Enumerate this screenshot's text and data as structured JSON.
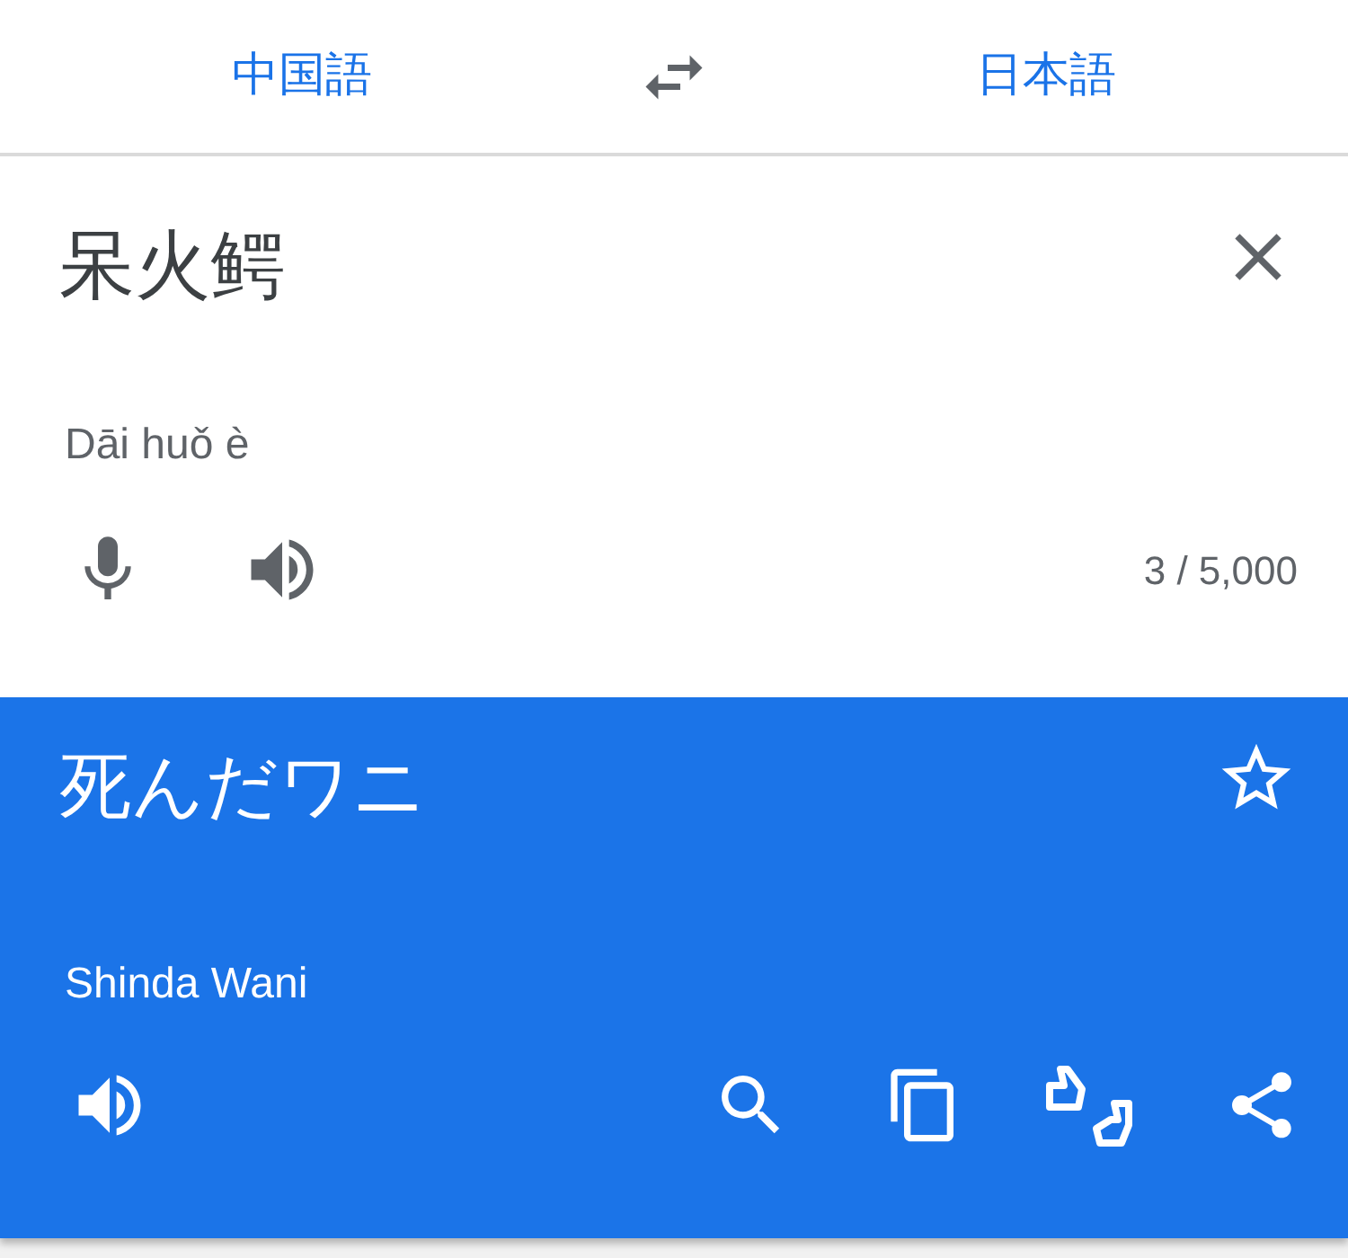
{
  "language_bar": {
    "source_language": "中国語",
    "target_language": "日本語"
  },
  "input": {
    "text": "呆火鳄",
    "transliteration": "Dāi huǒ è",
    "char_count": "3 / 5,000"
  },
  "output": {
    "text": "死んだワニ",
    "transliteration": "Shinda Wani",
    "starred": false
  }
}
